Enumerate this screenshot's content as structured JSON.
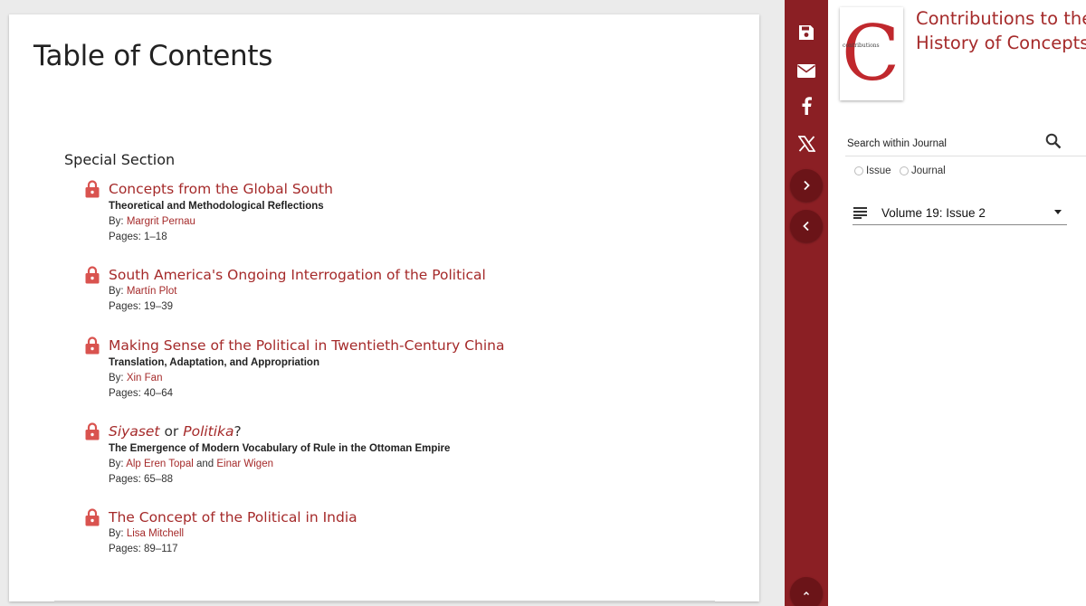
{
  "main": {
    "page_title": "Table of Contents",
    "section_heading": "Special Section",
    "by_label": "By:",
    "pages_label": "Pages:",
    "articles": [
      {
        "title": "Concepts from the Global South",
        "subtitle": "Theoretical and Methodological Reflections",
        "authors": [
          "Margrit Pernau"
        ],
        "pages": "1–18"
      },
      {
        "title": "South America's Ongoing Interrogation of the Political",
        "subtitle": "",
        "authors": [
          "Martín Plot"
        ],
        "pages": "19–39"
      },
      {
        "title": "Making Sense of the Political in Twentieth-Century China",
        "subtitle": "Translation, Adaptation, and Appropriation",
        "authors": [
          "Xin Fan"
        ],
        "pages": "40–64"
      },
      {
        "title_parts": [
          "Siyaset",
          " or ",
          "Politika",
          "?"
        ],
        "subtitle": "The Emergence of Modern Vocabulary of Rule in the Ottoman Empire",
        "authors": [
          "Alp Eren Topal",
          "Einar Wigen"
        ],
        "author_joiner": " and ",
        "pages": "65–88"
      },
      {
        "title": "The Concept of the Political in India",
        "subtitle": "",
        "authors": [
          "Lisa Mitchell"
        ],
        "pages": "89–117"
      }
    ]
  },
  "toolbar": {
    "icons": [
      "save-icon",
      "mail-icon",
      "facebook-icon",
      "x-icon",
      "chevron-right-icon",
      "chevron-left-icon",
      "chevron-up-icon"
    ]
  },
  "sidebar": {
    "journal_title_line1": "Contributions to the",
    "journal_title_line2": "History of Concepts",
    "cover_letter": "C",
    "cover_text": "contributions",
    "search_label": "Search within Journal",
    "radio_issue": "Issue",
    "radio_journal": "Journal",
    "volume_select": "Volume 19: Issue 2"
  },
  "colors": {
    "accent": "#a52a2a",
    "toolbar_bg": "#8b1f24",
    "toolbar_button": "#6b1418",
    "lock": "#d9534f"
  }
}
